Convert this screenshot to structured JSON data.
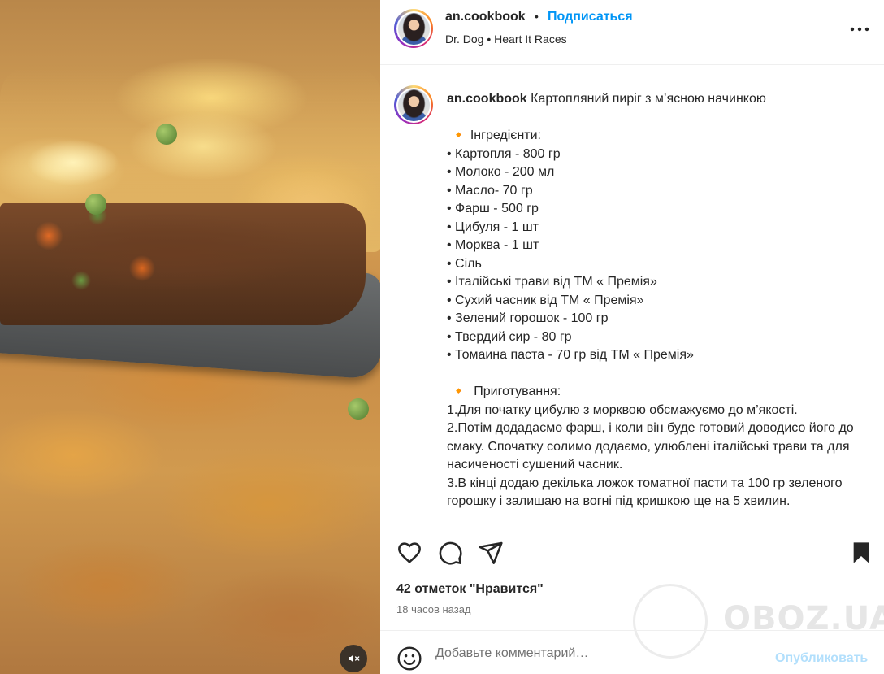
{
  "header": {
    "username": "an.cookbook",
    "dot": "•",
    "follow_label": "Подписаться",
    "music": "Dr. Dog • Heart It Races",
    "more_icon": "more-horizontal-icon"
  },
  "caption": {
    "username": "an.cookbook",
    "text": " Картопляний пиріг з м’ясною начинкою\n\n 🔸 Інгредієнти:\n• Картопля - 800 гр\n• Молоко - 200 мл\n• Масло- 70 гр\n• Фарш - 500 гр\n• Цибуля - 1 шт\n• Морква - 1 шт\n• Сіль\n• Італійські трави від ТМ « Премія»\n• Сухий часник від ТМ « Премія»\n• Зелений горошок - 100 гр\n• Твердий сир - 80 гр\n• Томаина паста - 70 гр від ТМ « Премія»\n\n 🔸  Приготування:\n1.Для початку цибулю з морквою обсмажуємо до м’якості.\n2.Потім додадаємо фарш, і коли він буде готовий доводисо його до смаку. Спочатку солимо додаємо, улюблені італійські трави та для насиченості сушений часник.\n3.В кінці додаю декілька ложок томатної пасти та 100 гр зеленого горошку і залишаю на вогні під кришкою ще на 5 хвилин."
  },
  "engagement": {
    "likes": "42 отметок \"Нравится\"",
    "time": "18 часов назад"
  },
  "comment": {
    "placeholder": "Добавьте комментарий…",
    "post_label": "Опубликовать"
  },
  "watermark": {
    "text": "OBOZ.UA"
  },
  "colors": {
    "accent": "#0095f6",
    "post_disabled": "#b2dffc",
    "text": "#262626",
    "muted": "#737373"
  }
}
